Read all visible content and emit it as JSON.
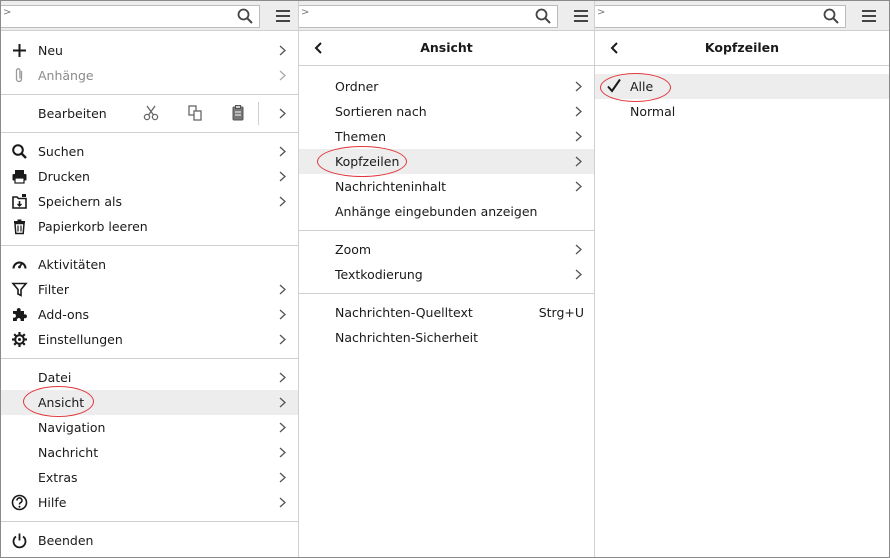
{
  "colors": {
    "accent_circle": "#e0383e",
    "selected_row": "#ededed",
    "separator": "#d0d0d0",
    "topbar": "#ededed"
  },
  "main_menu": {
    "items": [
      {
        "label": "Neu",
        "icon": "plus-icon"
      },
      {
        "label": "Anhänge",
        "icon": "paperclip-icon",
        "disabled": true
      },
      {
        "label": "Bearbeiten",
        "tools": [
          "scissors-icon",
          "copy-icon",
          "clipboard-icon"
        ]
      },
      {
        "label": "Suchen",
        "icon": "search-icon"
      },
      {
        "label": "Drucken",
        "icon": "printer-icon"
      },
      {
        "label": "Speichern als",
        "icon": "save-as-icon"
      },
      {
        "label": "Papierkorb leeren",
        "icon": "trash-icon"
      },
      {
        "label": "Aktivitäten",
        "icon": "gauge-icon"
      },
      {
        "label": "Filter",
        "icon": "funnel-icon"
      },
      {
        "label": "Add-ons",
        "icon": "puzzle-icon"
      },
      {
        "label": "Einstellungen",
        "icon": "gear-icon"
      },
      {
        "label": "Datei"
      },
      {
        "label": "Ansicht",
        "selected": true
      },
      {
        "label": "Navigation"
      },
      {
        "label": "Nachricht"
      },
      {
        "label": "Extras"
      },
      {
        "label": "Hilfe",
        "icon": "help-icon"
      },
      {
        "label": "Beenden",
        "icon": "power-icon"
      }
    ]
  },
  "ansicht_menu": {
    "title": "Ansicht",
    "items": [
      {
        "label": "Ordner"
      },
      {
        "label": "Sortieren nach"
      },
      {
        "label": "Themen"
      },
      {
        "label": "Kopfzeilen",
        "selected": true
      },
      {
        "label": "Nachrichteninhalt"
      },
      {
        "label": "Anhänge eingebunden anzeigen"
      },
      {
        "label": "Zoom"
      },
      {
        "label": "Textkodierung"
      },
      {
        "label": "Nachrichten-Quelltext",
        "shortcut": "Strg+U"
      },
      {
        "label": "Nachrichten-Sicherheit"
      }
    ]
  },
  "kopfzeilen_menu": {
    "title": "Kopfzeilen",
    "items": [
      {
        "label": "Alle",
        "checked": true
      },
      {
        "label": "Normal"
      }
    ]
  }
}
